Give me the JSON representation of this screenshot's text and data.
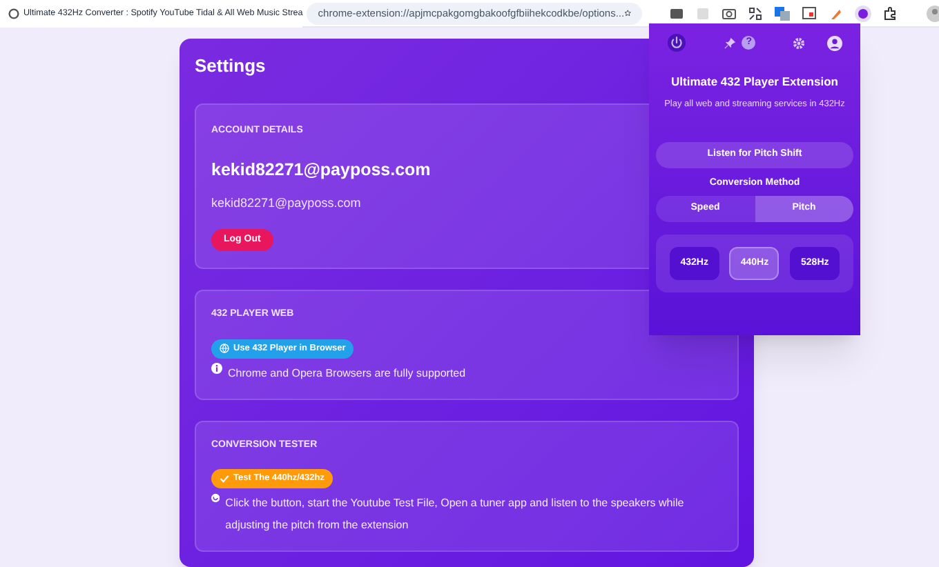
{
  "browser": {
    "tab_title": "Ultimate 432Hz Converter : Spotify YouTube Tidal & All Web Music Strea",
    "url": "chrome-extension://apjmcpakgomgbakoofgfbiihekcodkbe/options..."
  },
  "settings": {
    "title": "Settings",
    "sections": [
      {
        "kind": "account",
        "heading": "ACCOUNT DETAILS",
        "name": "kekid82271@payposs.com",
        "email": "kekid82271@payposs.com",
        "button": "Log Out"
      },
      {
        "kind": "web",
        "heading": "432 PLAYER WEB",
        "button": "Use 432 Player in Browser",
        "note": "Chrome and Opera Browsers are fully supported"
      },
      {
        "kind": "tester",
        "heading": "CONVERSION TESTER",
        "button": "Test The 440hz/432hz",
        "note": "Click the button, start the Youtube Test File, Open a tuner app and listen to the speakers while adjusting the pitch from the extension"
      }
    ]
  },
  "popup": {
    "title": "Ultimate 432 Player Extension",
    "subtitle": "Play all web and streaming services in 432Hz",
    "help_badge": "?",
    "listen_button": "Listen for Pitch Shift",
    "method_label": "Conversion Method",
    "methods": [
      {
        "label": "Speed",
        "selected": false
      },
      {
        "label": "Pitch",
        "selected": true
      }
    ],
    "frequencies": [
      {
        "label": "432Hz",
        "selected": false
      },
      {
        "label": "440Hz",
        "selected": true
      },
      {
        "label": "528Hz",
        "selected": false
      }
    ]
  }
}
